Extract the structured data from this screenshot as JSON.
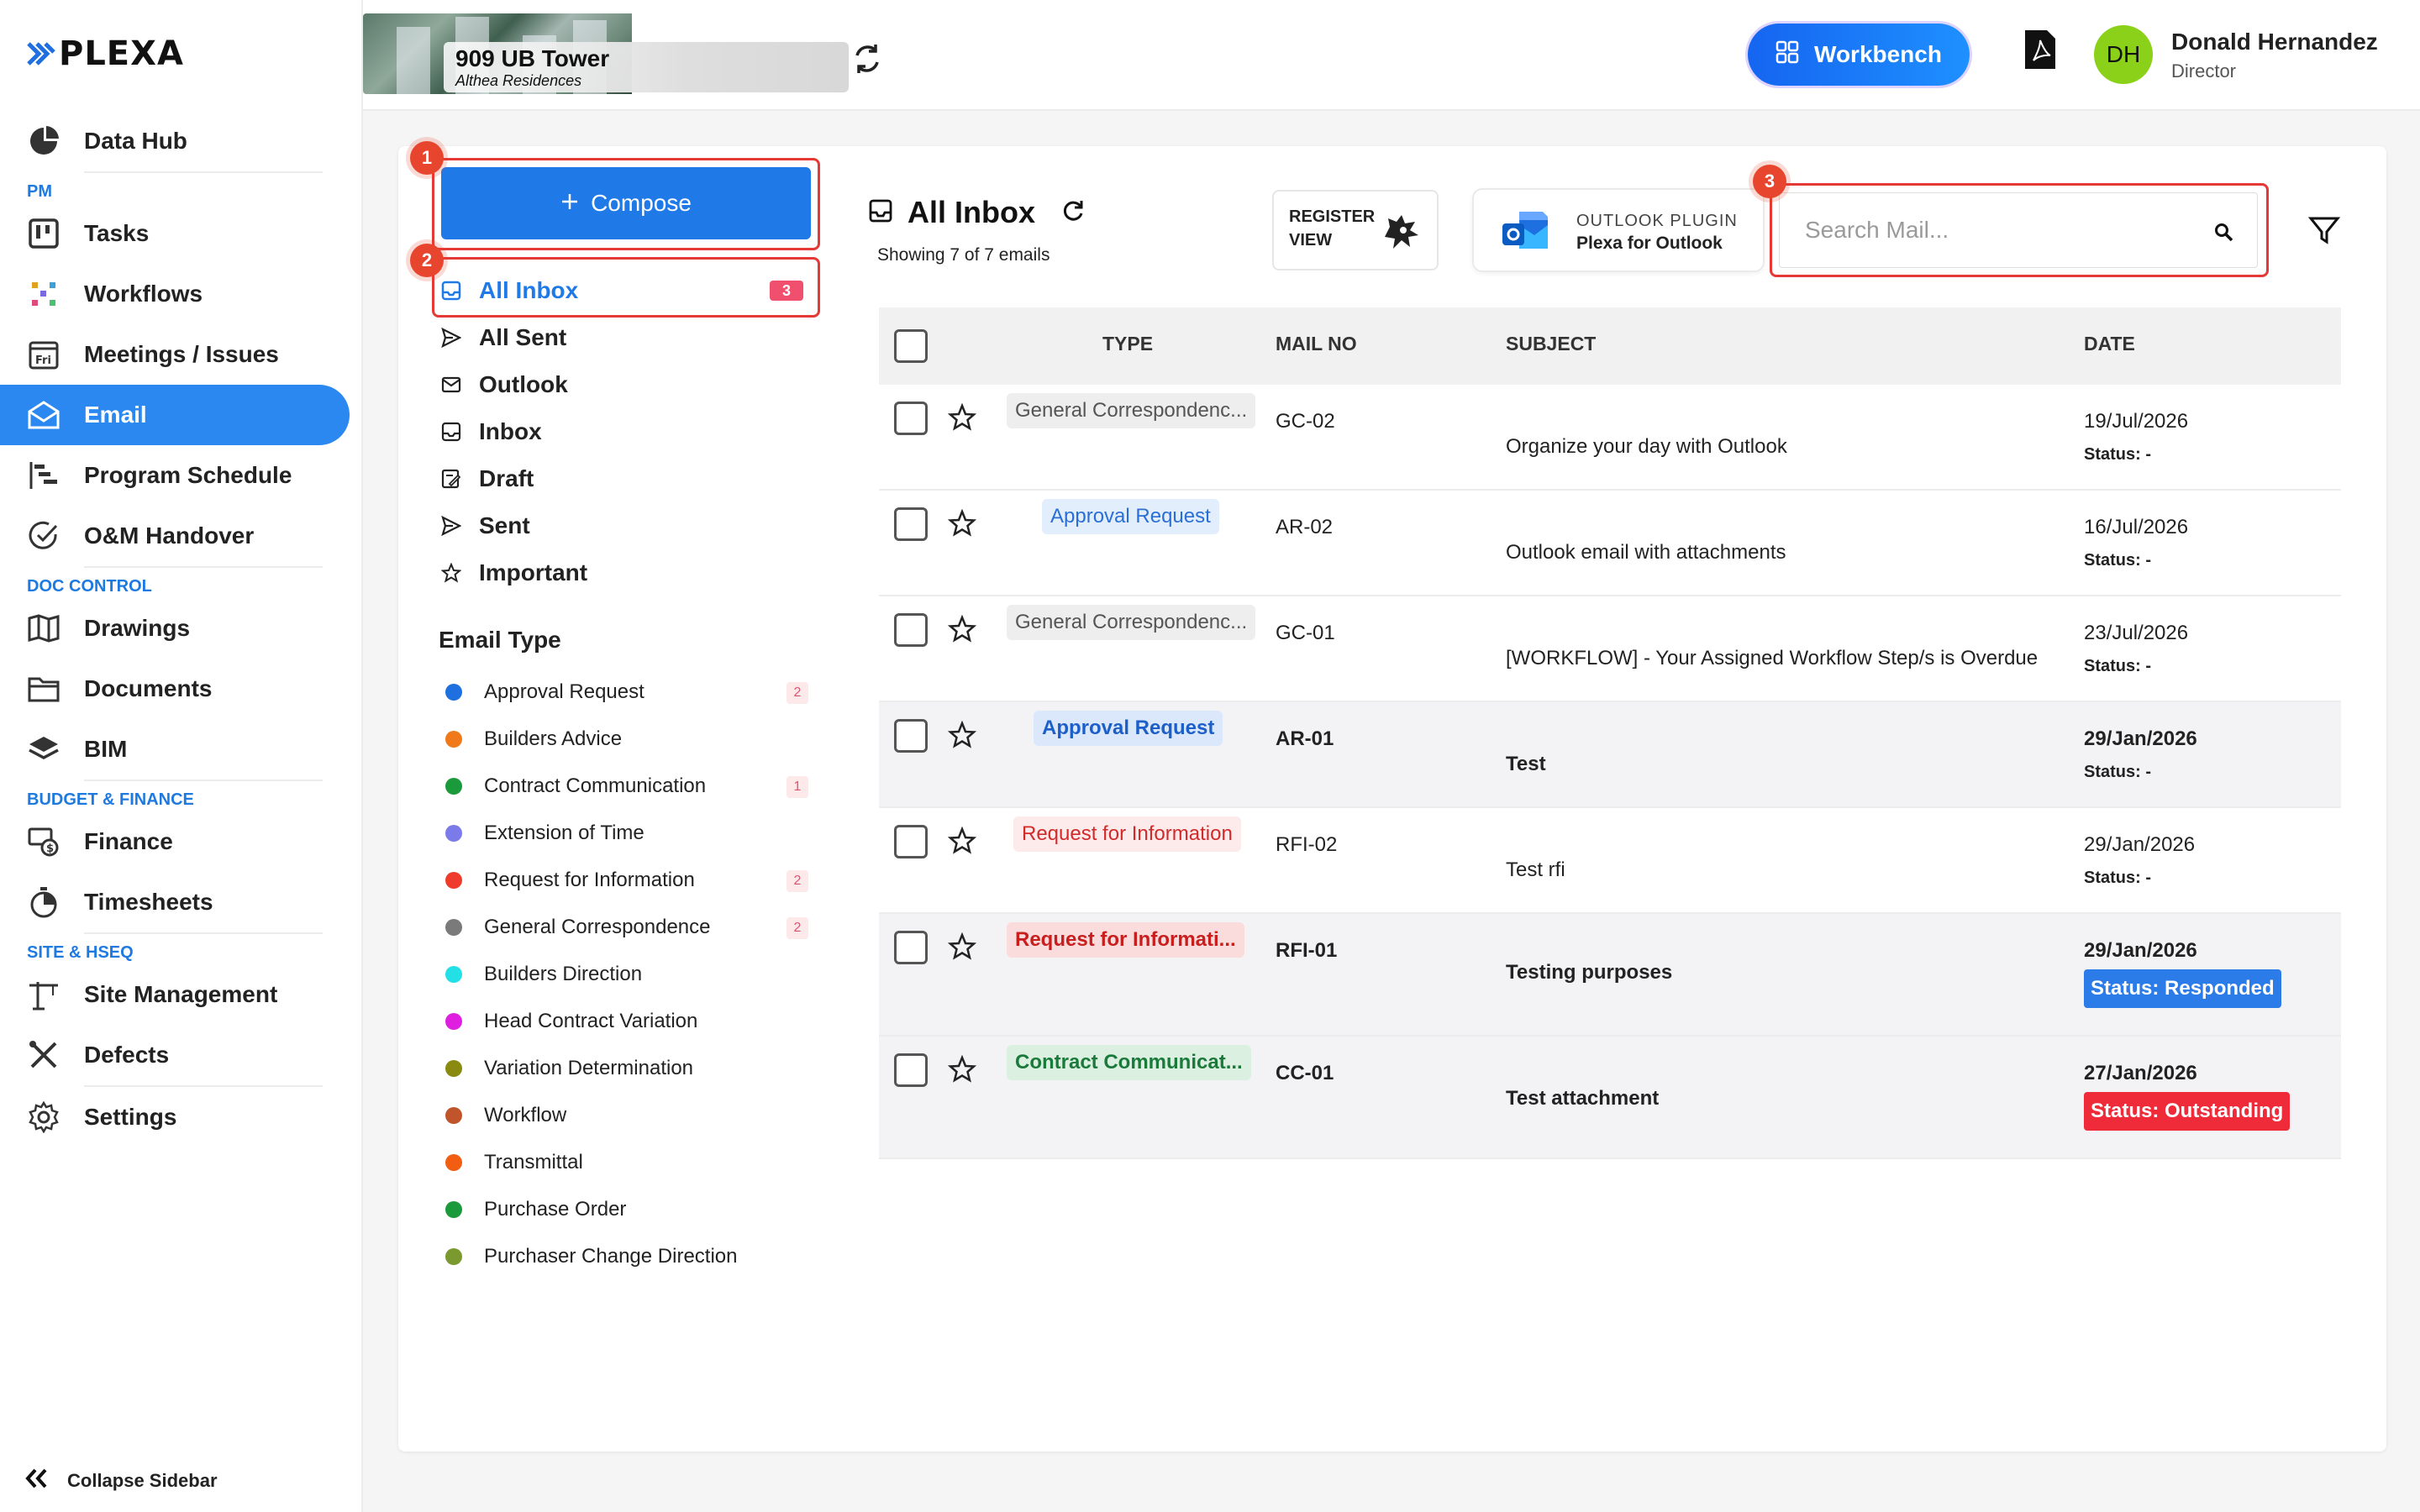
{
  "app": {
    "logo_text": "PLEXA"
  },
  "sidebar": {
    "items": [
      {
        "label": "Data Hub",
        "icon": "pie-chart-icon"
      },
      {
        "section": "PM"
      },
      {
        "label": "Tasks",
        "icon": "kanban-icon"
      },
      {
        "label": "Workflows",
        "icon": "workflow-icon"
      },
      {
        "label": "Meetings / Issues",
        "icon": "calendar-icon"
      },
      {
        "label": "Email",
        "icon": "mail-open-icon",
        "active": true
      },
      {
        "label": "Program Schedule",
        "icon": "gantt-icon"
      },
      {
        "label": "O&M Handover",
        "icon": "check-circle-icon"
      },
      {
        "section": "DOC CONTROL"
      },
      {
        "label": "Drawings",
        "icon": "map-icon"
      },
      {
        "label": "Documents",
        "icon": "folder-icon"
      },
      {
        "label": "BIM",
        "icon": "layers-icon"
      },
      {
        "section": "BUDGET & FINANCE"
      },
      {
        "label": "Finance",
        "icon": "finance-icon"
      },
      {
        "label": "Timesheets",
        "icon": "stopwatch-icon"
      },
      {
        "section": "SITE & HSEQ"
      },
      {
        "label": "Site Management",
        "icon": "crane-icon"
      },
      {
        "label": "Defects",
        "icon": "tools-icon"
      },
      {
        "label": "Settings",
        "icon": "gear-icon"
      }
    ],
    "collapse_label": "Collapse Sidebar"
  },
  "topbar": {
    "project_name": "909 UB Tower",
    "project_sub": "Althea Residences",
    "workbench_label": "Workbench",
    "user_initials": "DH",
    "user_name": "Donald Hernandez",
    "user_role": "Director"
  },
  "mail": {
    "compose_label": "Compose",
    "callouts": [
      "1",
      "2",
      "3"
    ],
    "folders": [
      {
        "label": "All Inbox",
        "icon": "inbox-icon",
        "count": "3",
        "active": true
      },
      {
        "label": "All Sent",
        "icon": "send-icon"
      },
      {
        "label": "Outlook",
        "icon": "envelope-icon"
      },
      {
        "label": "Inbox",
        "icon": "inbox-icon"
      },
      {
        "label": "Draft",
        "icon": "draft-icon"
      },
      {
        "label": "Sent",
        "icon": "send-icon"
      },
      {
        "label": "Important",
        "icon": "star-icon"
      }
    ],
    "email_type_title": "Email Type",
    "email_types": [
      {
        "label": "Approval Request",
        "color": "#1e6fe0",
        "count": "2"
      },
      {
        "label": "Builders Advice",
        "color": "#f07a1a",
        "count": ""
      },
      {
        "label": "Contract Communication",
        "color": "#1a9a3a",
        "count": "1"
      },
      {
        "label": "Extension of Time",
        "color": "#7a7ae8",
        "count": ""
      },
      {
        "label": "Request for Information",
        "color": "#ef3b2c",
        "count": "2"
      },
      {
        "label": "General Correspondence",
        "color": "#7a7a7a",
        "count": "2"
      },
      {
        "label": "Builders Direction",
        "color": "#22e0e6",
        "count": ""
      },
      {
        "label": "Head Contract Variation",
        "color": "#e01ee0",
        "count": ""
      },
      {
        "label": "Variation Determination",
        "color": "#8a8a10",
        "count": ""
      },
      {
        "label": "Workflow",
        "color": "#c0542a",
        "count": ""
      },
      {
        "label": "Transmittal",
        "color": "#f25d12",
        "count": ""
      },
      {
        "label": "Purchase Order",
        "color": "#1a9a3a",
        "count": ""
      },
      {
        "label": "Purchaser Change Direction",
        "color": "#7a9a30",
        "count": ""
      }
    ],
    "inbox_title": "All Inbox",
    "showing_text": "Showing 7 of 7 emails",
    "register_line1": "REGISTER",
    "register_line2": "VIEW",
    "outlook_top": "OUTLOOK PLUGIN",
    "outlook_bottom": "Plexa for Outlook",
    "search_placeholder": "Search Mail...",
    "columns": {
      "type": "TYPE",
      "mail_no": "MAIL NO",
      "subject": "SUBJECT",
      "date": "DATE"
    },
    "rows": [
      {
        "type": "General Correspondenc...",
        "type_kind": "gc",
        "mail_no": "GC-02",
        "subject": "Organize your day with Outlook",
        "date": "19/Jul/2026",
        "status": "Status: -",
        "unread": false
      },
      {
        "type": "Approval Request",
        "type_kind": "ar",
        "mail_no": "AR-02",
        "subject": "Outlook email with attachments",
        "date": "16/Jul/2026",
        "status": "Status: -",
        "unread": false
      },
      {
        "type": "General Correspondenc...",
        "type_kind": "gc",
        "mail_no": "GC-01",
        "subject": "[WORKFLOW] - Your Assigned Workflow Step/s is Overdue",
        "date": "23/Jul/2026",
        "status": "Status: -",
        "unread": false
      },
      {
        "type": "Approval Request",
        "type_kind": "ar",
        "mail_no": "AR-01",
        "subject": "Test",
        "date": "29/Jan/2026",
        "status": "Status: -",
        "unread": true
      },
      {
        "type": "Request for Information",
        "type_kind": "rfi",
        "mail_no": "RFI-02",
        "subject": "Test rfi",
        "date": "29/Jan/2026",
        "status": "Status: -",
        "unread": false
      },
      {
        "type": "Request for Informati...",
        "type_kind": "rfi",
        "mail_no": "RFI-01",
        "subject": "Testing purposes",
        "date": "29/Jan/2026",
        "status": "Status: Responded",
        "status_color": "#2b7be8",
        "unread": true
      },
      {
        "type": "Contract Communicat...",
        "type_kind": "cc",
        "mail_no": "CC-01",
        "subject": "Test attachment",
        "date": "27/Jan/2026",
        "status": "Status: Outstanding",
        "status_color": "#ef2b3a",
        "unread": true
      }
    ]
  }
}
